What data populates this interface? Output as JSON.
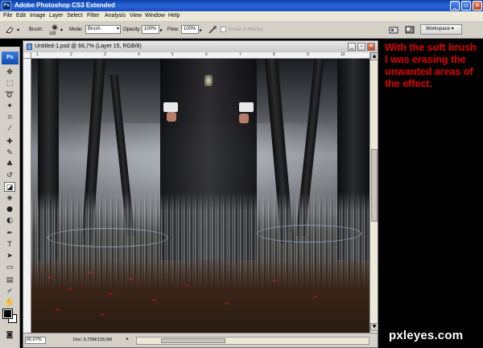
{
  "app": {
    "title": "Adobe Photoshop CS3 Extended",
    "logo": "Ps"
  },
  "menu": [
    "File",
    "Edit",
    "Image",
    "Layer",
    "Select",
    "Filter",
    "Analysis",
    "View",
    "Window",
    "Help"
  ],
  "options": {
    "brush_label": "Brush:",
    "brush_size": "100",
    "mode_label": "Mode:",
    "mode_value": "Brush",
    "opacity_label": "Opacity:",
    "opacity_value": "100%",
    "flow_label": "Flow:",
    "flow_value": "100%",
    "erase_history": "Erase to History",
    "workspace": "Workspace"
  },
  "document": {
    "title": "Untitled-1.psd @ 66,7% (Layer 15, RGB/8)",
    "zoom": "66,67%",
    "doc_size": "Doc: 6,75M/133,0M",
    "ruler_numbers": [
      "1",
      "2",
      "3",
      "4",
      "5",
      "6",
      "7",
      "8",
      "9",
      "10"
    ]
  },
  "annotation": "With the soft brush I was erasing the unwanted areas of the effect.",
  "watermark": "pxleyes.com",
  "colors": {
    "annotation": "#e00000",
    "titlebar": "#2a66d6",
    "foreground_swatch": "#000000",
    "background_swatch": "#ffffff"
  },
  "icons": [
    "eraser-icon",
    "brush-preset-icon",
    "airbrush-icon",
    "palette-icon",
    "workspace-icon"
  ]
}
